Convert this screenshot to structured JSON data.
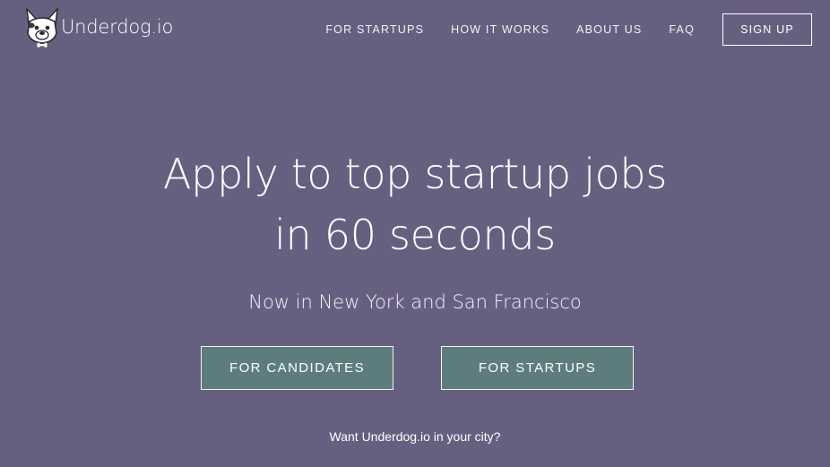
{
  "brand": {
    "name": "Underdog.io",
    "logo_icon": "dog-icon"
  },
  "nav": {
    "items": [
      {
        "label": "FOR STARTUPS"
      },
      {
        "label": "HOW IT WORKS"
      },
      {
        "label": "ABOUT US"
      },
      {
        "label": "FAQ"
      }
    ],
    "signup_label": "SIGN UP"
  },
  "hero": {
    "title_line1": "Apply to top startup jobs",
    "title_line2": "in 60 seconds",
    "subtitle": "Now in New York and San Francisco",
    "cta_candidates": "FOR CANDIDATES",
    "cta_startups": "FOR STARTUPS",
    "city_link": "Want Underdog.io in your city?"
  },
  "colors": {
    "background": "#675f80",
    "button_fill": "#5d7c7d",
    "text": "#ffffff"
  }
}
